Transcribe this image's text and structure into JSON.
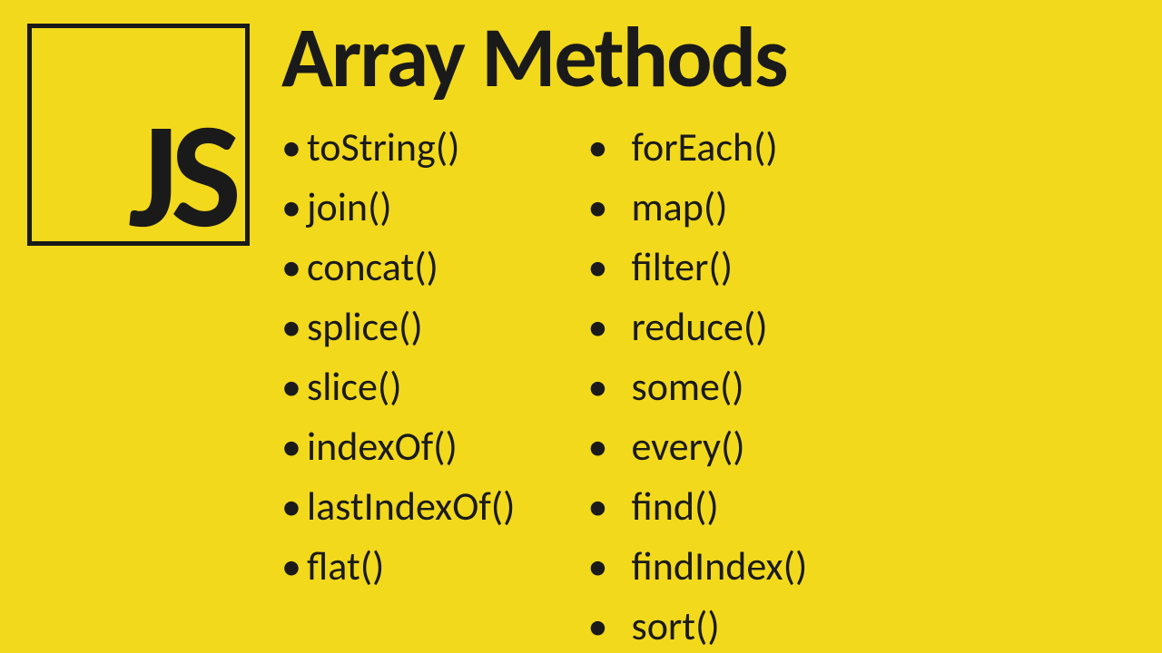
{
  "logo": {
    "text": "JS"
  },
  "title": "Array Methods",
  "columns": {
    "left": [
      "toString()",
      "join()",
      "concat()",
      "splice()",
      "slice()",
      "indexOf()",
      "lastIndexOf()",
      "flat()"
    ],
    "right": [
      "forEach()",
      "map()",
      "filter()",
      "reduce()",
      "some()",
      "every()",
      "find()",
      "findIndex()",
      "sort()"
    ]
  }
}
